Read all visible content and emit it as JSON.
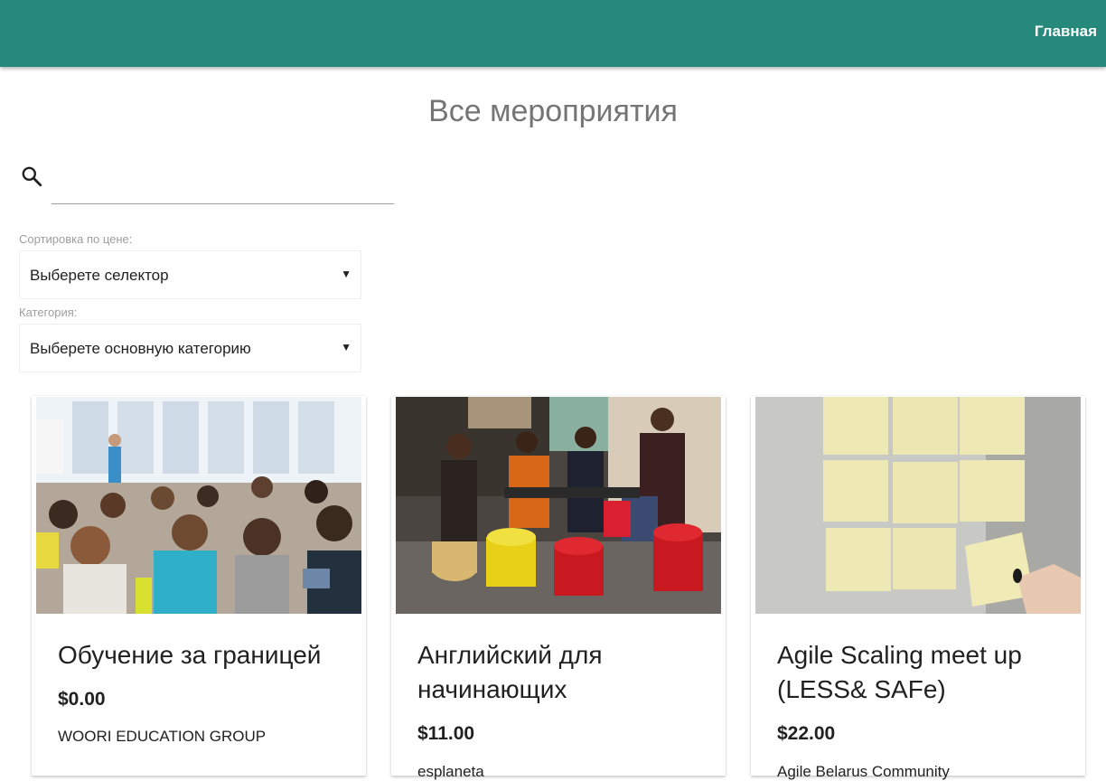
{
  "header": {
    "nav_home": "Главная",
    "color": "#26897b"
  },
  "page": {
    "title": "Все мероприятия"
  },
  "search": {
    "placeholder": "",
    "value": "",
    "icon": "search-icon"
  },
  "filters": {
    "price_sort": {
      "label": "Сортировка по цене:",
      "selected": "Выберете селектор"
    },
    "category": {
      "label": "Категория:",
      "selected": "Выберете основную категорию"
    }
  },
  "events": [
    {
      "title": "Обучение за границей",
      "price": "$0.00",
      "organizer": "WOORI EDUCATION GROUP",
      "image": "conference-audience-photo"
    },
    {
      "title": "Английский для начинающих",
      "price": "$11.00",
      "organizer": "esplaneta",
      "image": "group-meeting-photo"
    },
    {
      "title": "Agile Scaling meet up (LESS& SAFe)",
      "price": "$22.00",
      "organizer": "Agile Belarus Community",
      "image": "sticky-notes-photo"
    }
  ]
}
